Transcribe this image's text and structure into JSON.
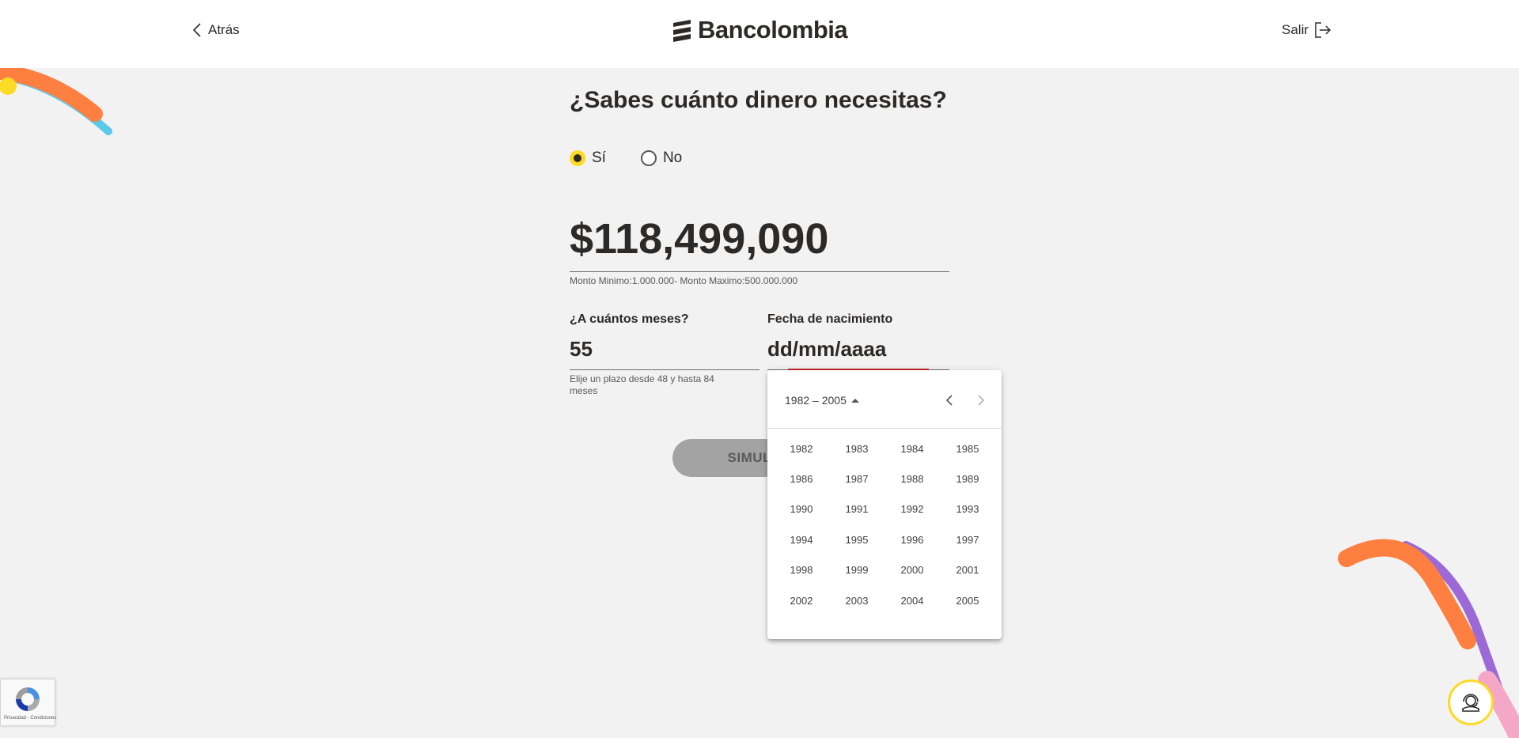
{
  "header": {
    "back_label": "Atrás",
    "logo_text": "Bancolombia",
    "exit_label": "Salir"
  },
  "form": {
    "title": "¿Sabes cuánto dinero necesitas?",
    "radio_options": [
      {
        "label": "Sí",
        "checked": true
      },
      {
        "label": "No",
        "checked": false
      }
    ],
    "amount_value": "$118,499,090",
    "amount_hint": "Monto Minimo:1.000.000- Monto Maximo:500.000.000",
    "months_label": "¿A cuántos meses?",
    "months_value": "55",
    "months_hint": "Elije un plazo desde 48 y hasta 84 meses",
    "birthdate_label": "Fecha de nacimiento",
    "birthdate_placeholder": "dd/mm/aaaa",
    "simulate_label": "SIMULAR"
  },
  "datepicker": {
    "period_label": "1982 – 2005",
    "years": [
      "1982",
      "1983",
      "1984",
      "1985",
      "1986",
      "1987",
      "1988",
      "1989",
      "1990",
      "1991",
      "1992",
      "1993",
      "1994",
      "1995",
      "1996",
      "1997",
      "1998",
      "1999",
      "2000",
      "2001",
      "2002",
      "2003",
      "2004",
      "2005"
    ]
  },
  "recaptcha": {
    "links": "Privacidad - Condiciones"
  },
  "icons": {
    "back": "chevron-left-icon",
    "exit": "logout-icon",
    "help": "headset-icon",
    "prev": "chevron-left-icon",
    "next": "chevron-right-icon"
  },
  "colors": {
    "brand_yellow": "#fdda24",
    "background": "#f2f2f2",
    "text": "#2c2a29",
    "error_red": "#c62828",
    "deco_orange": "#ff7f41",
    "deco_blue": "#59cbe8",
    "deco_purple": "#9c6ad6",
    "deco_pink": "#f5a7c7"
  }
}
